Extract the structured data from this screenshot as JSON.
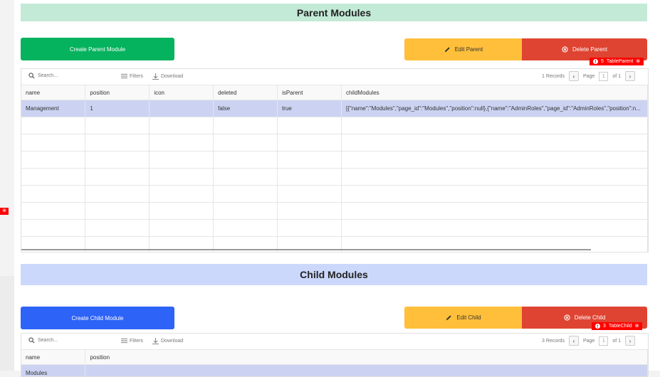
{
  "parent_section": {
    "title": "Parent Modules",
    "create_label": "Create Parent Module",
    "edit_label": "Edit Parent",
    "delete_label": "Delete Parent",
    "error_badge": {
      "count": "5",
      "name": "TableParent"
    },
    "table": {
      "search_placeholder": "Search...",
      "filters_label": "Filters",
      "download_label": "Download",
      "records": "1 Records",
      "page_label": "Page",
      "page_value": "1",
      "of_label": "of 1",
      "columns": [
        "name",
        "position",
        "icon",
        "deleted",
        "isParent",
        "childModules"
      ],
      "rows": [
        [
          "Management",
          "1",
          "",
          "false",
          "true",
          "[{\"name\":\"Modules\",\"page_id\":\"Modules\",\"position\":null},{\"name\":\"AdminRoles\",\"page_id\":\"AdminRoles\",\"position\":n..."
        ]
      ]
    }
  },
  "child_section": {
    "title": "Child Modules",
    "create_label": "Create Child Module",
    "edit_label": "Edit Child",
    "delete_label": "Delete Child",
    "error_badge": {
      "count": "3",
      "name": "TableChild"
    },
    "table": {
      "search_placeholder": "Search...",
      "filters_label": "Filters",
      "download_label": "Download",
      "records": "3 Records",
      "page_label": "Page",
      "page_value": "1",
      "of_label": "of 1",
      "columns": [
        "name",
        "position"
      ],
      "rows": [
        [
          "Modules",
          ""
        ]
      ]
    }
  },
  "colors": {
    "parent_header_bg": "#c2ead7",
    "child_header_bg": "#ccd8fb",
    "create_parent": "#05b25e",
    "create_child": "#2e63f7",
    "edit": "#ffbf3a",
    "delete": "#df4432",
    "error": "#ff0000",
    "selected_row": "#ccd3f2"
  },
  "icons": {
    "edit": "pencil-icon",
    "delete": "circle-x-icon",
    "search": "search-icon",
    "filters": "filter-lines-icon",
    "download": "download-icon",
    "error": "alert-circle-icon"
  }
}
